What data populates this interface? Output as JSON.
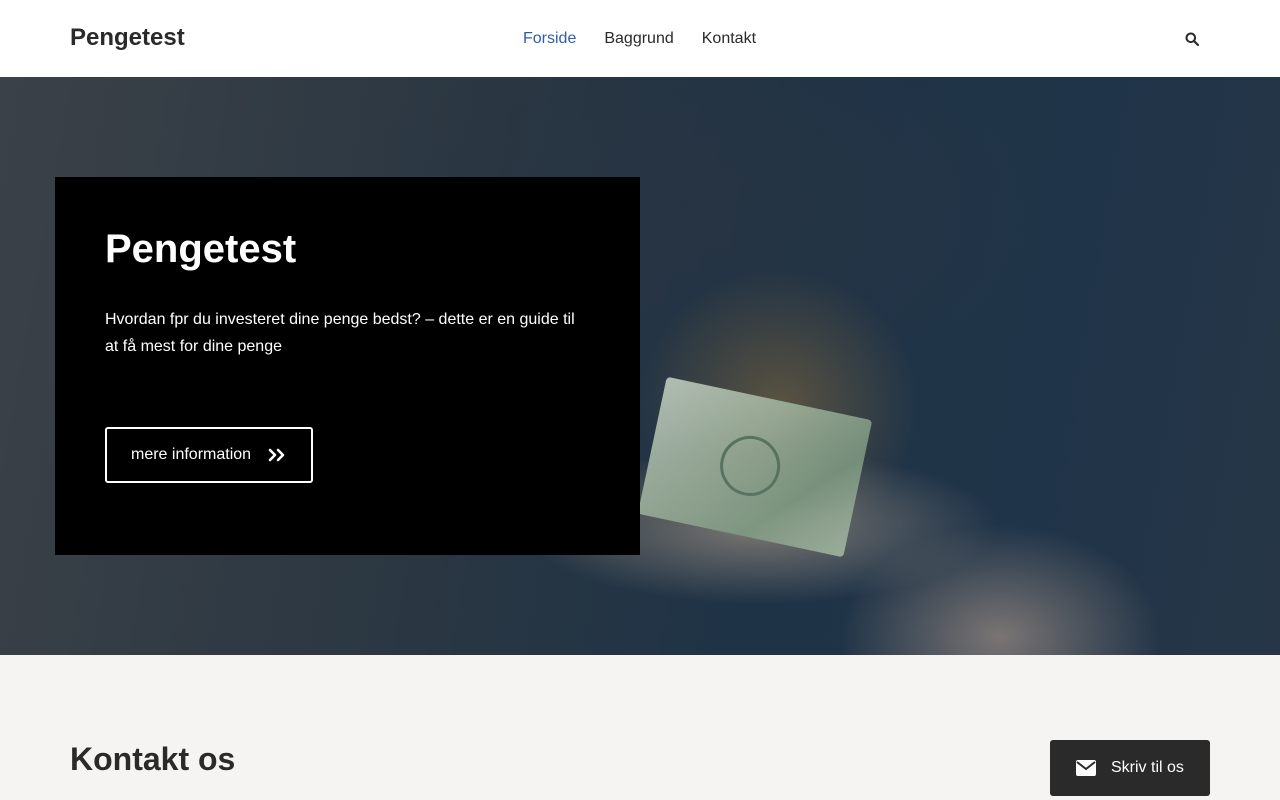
{
  "header": {
    "logo": "Pengetest",
    "nav": [
      {
        "label": "Forside",
        "active": true
      },
      {
        "label": "Baggrund",
        "active": false
      },
      {
        "label": "Kontakt",
        "active": false
      }
    ],
    "search_icon": "search-icon"
  },
  "hero": {
    "title": "Pengetest",
    "description": "Hvordan fpr du investeret dine penge bedst? – dette er en guide til at få mest for dine penge",
    "cta_label": "mere information",
    "cta_icon": "double-chevron-right-icon",
    "background_image": "hands-holding-dollar-bills"
  },
  "contact": {
    "title": "Kontakt os",
    "write_button_label": "Skriv til os",
    "write_button_icon": "envelope-icon"
  },
  "colors": {
    "nav_active": "#2f5ea8",
    "text_dark": "#2a2a2a",
    "hero_box": "#000000",
    "write_button_bg": "#2a2a2a",
    "page_bg": "#f5f4f2"
  }
}
